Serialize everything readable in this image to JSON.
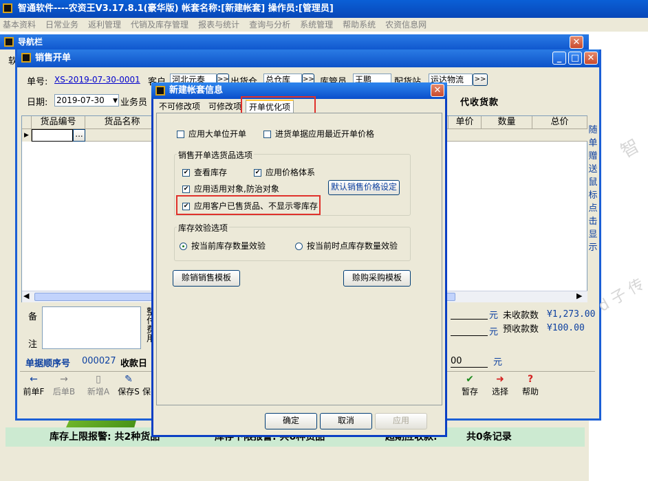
{
  "app": {
    "title": "智通软件----农资王V3.17.8.1(豪华版)    帐套名称:[新建帐套]   操作员:[管理员]",
    "menu": [
      "基本资料",
      "日常业务",
      "返利管理",
      "代销及库存管理",
      "报表与统计",
      "查询与分析",
      "系统管理",
      "帮助系统",
      "农资信息网"
    ]
  },
  "nav_window": {
    "title": "导航栏",
    "first_char": "软"
  },
  "sales_window": {
    "title": "销售开单",
    "order_no_label": "单号:",
    "order_no": "XS-2019-07-30-0001",
    "customer_label": "客户",
    "customer": "河北元泰",
    "warehouse_label": "出货仓",
    "warehouse": "总仓库",
    "keeper_label": "库管员",
    "keeper": "王鹏",
    "delivery_label": "配货站",
    "delivery": "运达物流",
    "date_label": "日期:",
    "date": "2019-07-30",
    "salesman_label": "业务员",
    "collect_label": "代收货款",
    "columns": [
      "货品编号",
      "货品名称",
      "单价",
      "数量",
      "总价"
    ],
    "side_text": [
      "随",
      "单",
      "赠",
      "送",
      "鼠",
      "标",
      "点",
      "击",
      "显",
      "示"
    ],
    "remarks_label_top": "备",
    "remarks_label_bottom": "注",
    "mid_labels": [
      "整",
      "付",
      "费",
      "用"
    ],
    "unpaid_label": "未收款数",
    "unpaid_value": "¥1,273.00",
    "prepaid_label": "预收款数",
    "prepaid_value": "¥100.00",
    "yuan": "元",
    "amount_tail": "00",
    "seq_label": "单据顺序号",
    "seq_value": "000027",
    "received_label": "收款日",
    "toolbar": [
      {
        "label": "前单F",
        "icon": "arrow-left-icon",
        "glyph": "←",
        "enabled": true
      },
      {
        "label": "后单B",
        "icon": "arrow-right-icon",
        "glyph": "→",
        "enabled": false
      },
      {
        "label": "新增A",
        "icon": "new-document-icon",
        "glyph": "▯",
        "enabled": false
      },
      {
        "label": "保存S",
        "icon": "save-icon",
        "glyph": "✎",
        "enabled": true
      },
      {
        "label": "保",
        "icon": "",
        "glyph": "",
        "enabled": true
      }
    ],
    "toolbar_right": [
      {
        "label": "暂存",
        "icon": "check-arrow-icon",
        "glyph": "✔"
      },
      {
        "label": "选择",
        "icon": "select-arrow-icon",
        "glyph": "➜"
      },
      {
        "label": "帮助",
        "icon": "help-icon",
        "glyph": "?"
      }
    ]
  },
  "status_bar": {
    "stock_upper": "库存上限报警:  共2种货品",
    "stock_lower": "库存下限报警:  共0种货品",
    "overdue": "超期应收款:",
    "records": "共0条记录"
  },
  "dialog": {
    "title": "新建帐套信息",
    "tabs": [
      "不可修改项",
      "可修改项",
      "开单优化项"
    ],
    "options_top": [
      {
        "label": "应用大单位开单",
        "checked": false
      },
      {
        "label": "进货单据应用最近开单价格",
        "checked": false
      }
    ],
    "group1_title": "销售开单选货品选项",
    "group1_options": [
      {
        "label": "查看库存",
        "checked": true
      },
      {
        "label": "应用价格体系",
        "checked": true
      },
      {
        "label": "应用适用对象,防治对象",
        "checked": true
      },
      {
        "label": "应用客户已售货品、不显示零库存",
        "checked": true
      }
    ],
    "default_price_button": "默认销售价格设定",
    "group2_title": "库存效验选项",
    "radio_options": [
      {
        "label": "按当前库存数量效验",
        "selected": true
      },
      {
        "label": "按当前时点库存数量效验",
        "selected": false
      }
    ],
    "sales_template_button": "赊销销售模板",
    "purchase_template_button": "赊购采购模板",
    "ok_button": "确定",
    "cancel_button": "取消",
    "apply_button": "应用"
  },
  "watermark": [
    "智",
    "d 子 传"
  ],
  "colors": {
    "titlebar": "#0a5fd6",
    "highlight_box": "#e0302a",
    "status_bg": "#ccead1"
  }
}
